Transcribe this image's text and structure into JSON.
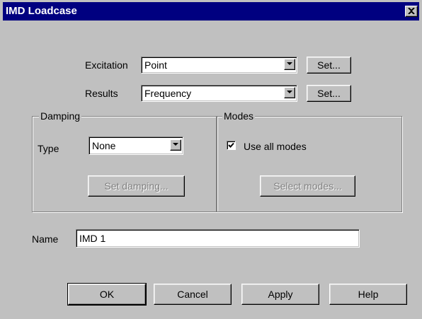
{
  "window": {
    "title": "IMD Loadcase"
  },
  "excitation": {
    "label": "Excitation",
    "value": "Point",
    "set_label": "Set..."
  },
  "results": {
    "label": "Results",
    "value": "Frequency",
    "set_label": "Set..."
  },
  "damping": {
    "group_title": "Damping",
    "type_label": "Type",
    "type_value": "None",
    "set_damping_label": "Set damping..."
  },
  "modes": {
    "group_title": "Modes",
    "use_all_label": "Use all modes",
    "use_all_checked": true,
    "select_modes_label": "Select modes..."
  },
  "name": {
    "label": "Name",
    "value": "IMD 1"
  },
  "buttons": {
    "ok": "OK",
    "cancel": "Cancel",
    "apply": "Apply",
    "help": "Help"
  },
  "colors": {
    "title_bar": "#000080",
    "face": "#c0c0c0",
    "disabled_text": "#808080"
  },
  "icons": {
    "close": "close-icon",
    "dropdown": "chevron-down-icon",
    "check": "check-icon"
  }
}
